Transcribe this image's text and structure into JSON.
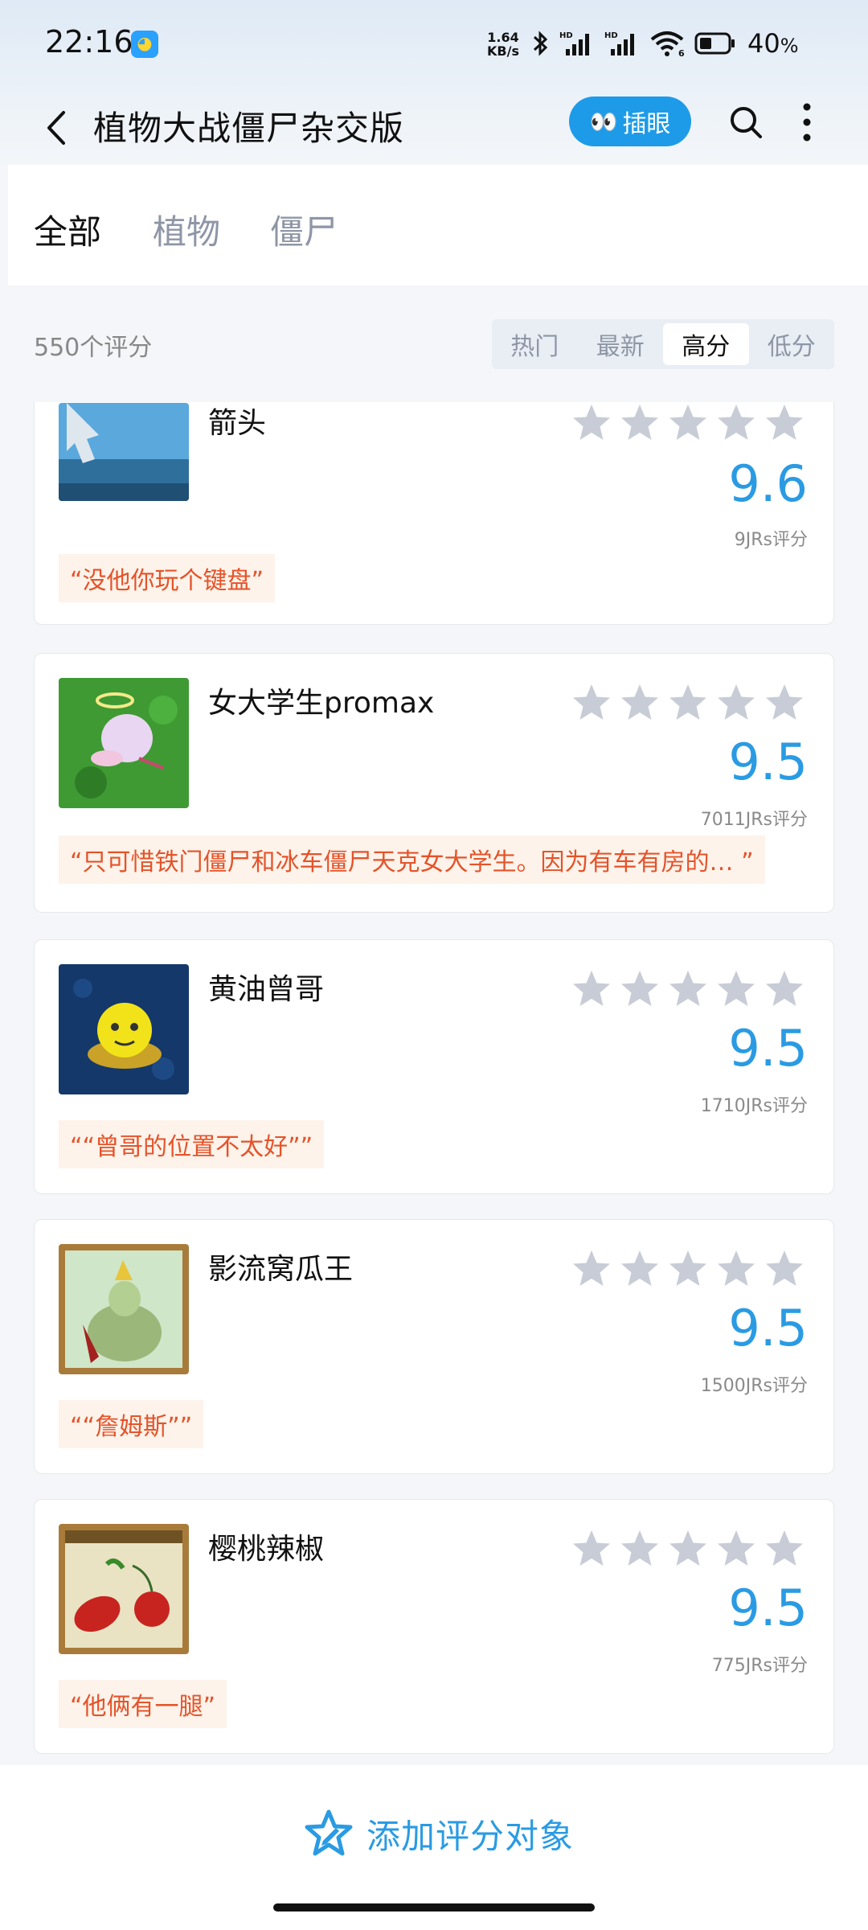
{
  "status_bar": {
    "time": "22:16",
    "net_speed_value": "1.64",
    "net_speed_unit": "KB/s",
    "battery_percent": "40",
    "battery_unit": "%",
    "icons": [
      "bluetooth-icon",
      "signal-hd-1-icon",
      "signal-hd-2-icon",
      "wifi-6-icon",
      "battery-icon"
    ]
  },
  "header": {
    "title": "植物大战僵尸杂交版",
    "peek_label": "插眼",
    "peek_icon": "👀"
  },
  "tabs": [
    {
      "label": "全部",
      "active": true
    },
    {
      "label": "植物",
      "active": false
    },
    {
      "label": "僵尸",
      "active": false
    }
  ],
  "rating_summary": "550个评分",
  "sort_options": [
    {
      "label": "热门",
      "active": false
    },
    {
      "label": "最新",
      "active": false
    },
    {
      "label": "高分",
      "active": true
    },
    {
      "label": "低分",
      "active": false
    }
  ],
  "items": [
    {
      "name": "箭头",
      "score": "9.6",
      "count": "9JRs评分",
      "quote": "“没他你玩个键盘”",
      "stars_filled": 0
    },
    {
      "name": "女大学生promax",
      "score": "9.5",
      "count": "7011JRs评分",
      "quote": "“只可惜铁门僵尸和冰车僵尸天克女大学生。因为有车有房的… ”",
      "stars_filled": 0
    },
    {
      "name": "黄油曾哥",
      "score": "9.5",
      "count": "1710JRs评分",
      "quote": "““曾哥的位置不太好””",
      "stars_filled": 0
    },
    {
      "name": "影流窝瓜王",
      "score": "9.5",
      "count": "1500JRs评分",
      "quote": "““詹姆斯””",
      "stars_filled": 0
    },
    {
      "name": "樱桃辣椒",
      "score": "9.5",
      "count": "775JRs评分",
      "quote": "“他俩有一腿”",
      "stars_filled": 0
    }
  ],
  "bottom": {
    "add_label": "添加评分对象"
  },
  "colors": {
    "accent": "#2a9be3",
    "peek_button": "#1d9be8",
    "quote_text": "#e5532a",
    "quote_bg": "#fdf3ea",
    "star_empty": "#c8ccd6"
  }
}
